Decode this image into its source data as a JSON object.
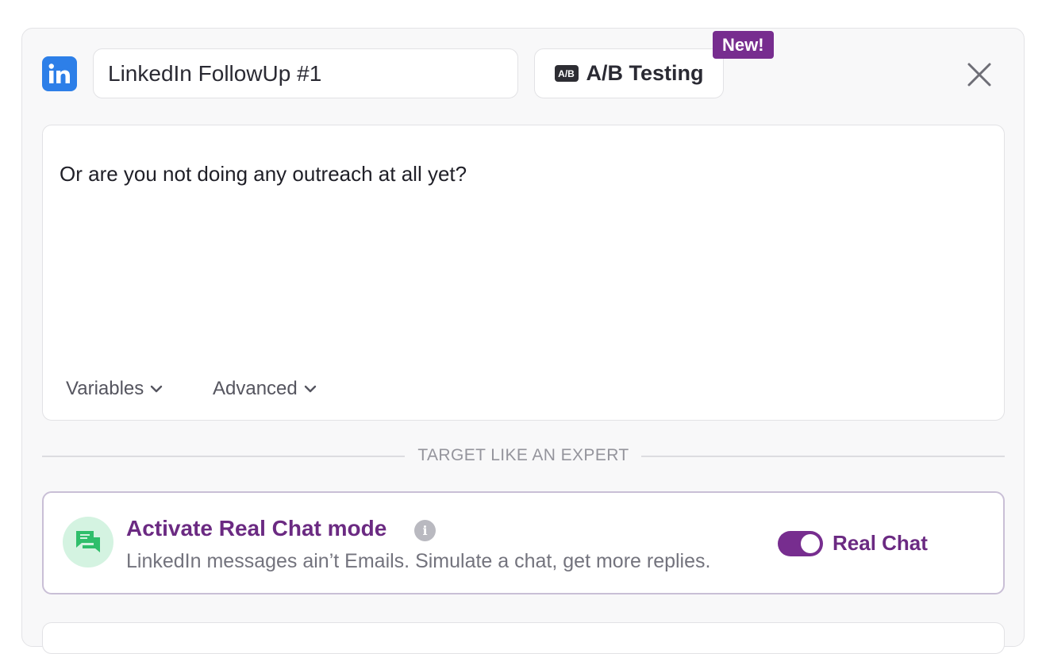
{
  "step": {
    "channel_icon": "linkedin-icon",
    "title_value": "LinkedIn FollowUp #1",
    "ab_button": {
      "badge": "A/B",
      "label": "A/B Testing"
    },
    "new_tag": "New!",
    "close_icon": "close-icon"
  },
  "editor": {
    "message": "Or are you not doing any outreach at all yet?",
    "variables_label": "Variables",
    "advanced_label": "Advanced"
  },
  "divider": {
    "label": "TARGET LIKE AN EXPERT"
  },
  "real_chat": {
    "icon": "chat-bubbles-icon",
    "title": "Activate Real Chat mode",
    "info_glyph": "i",
    "subtitle": "LinkedIn messages ain’t Emails. Simulate a chat, get more replies.",
    "toggle_on": true,
    "toggle_label": "Real Chat"
  },
  "colors": {
    "brand_purple": "#772d8f",
    "linkedin_blue": "#2d7fe8",
    "chat_green": "#2fbe6b"
  }
}
